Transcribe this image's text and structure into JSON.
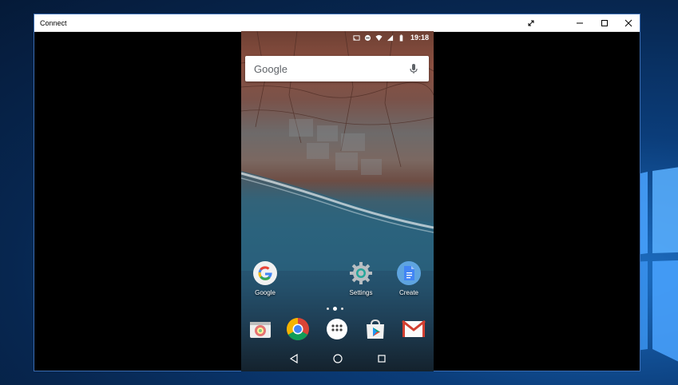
{
  "window": {
    "title": "Connect"
  },
  "phone": {
    "status": {
      "time": "19:18"
    },
    "search": {
      "label": "Google"
    },
    "home_apps": [
      {
        "label": "Google"
      },
      {
        "label": "Settings"
      },
      {
        "label": "Create"
      }
    ],
    "dock": [
      "camera-icon",
      "chrome-icon",
      "app-drawer-icon",
      "play-store-icon",
      "gmail-icon"
    ],
    "nav": [
      "back-icon",
      "home-icon",
      "recents-icon"
    ]
  },
  "colors": {
    "window_border": "#3b6db3",
    "desktop": "#0b3d7a"
  }
}
